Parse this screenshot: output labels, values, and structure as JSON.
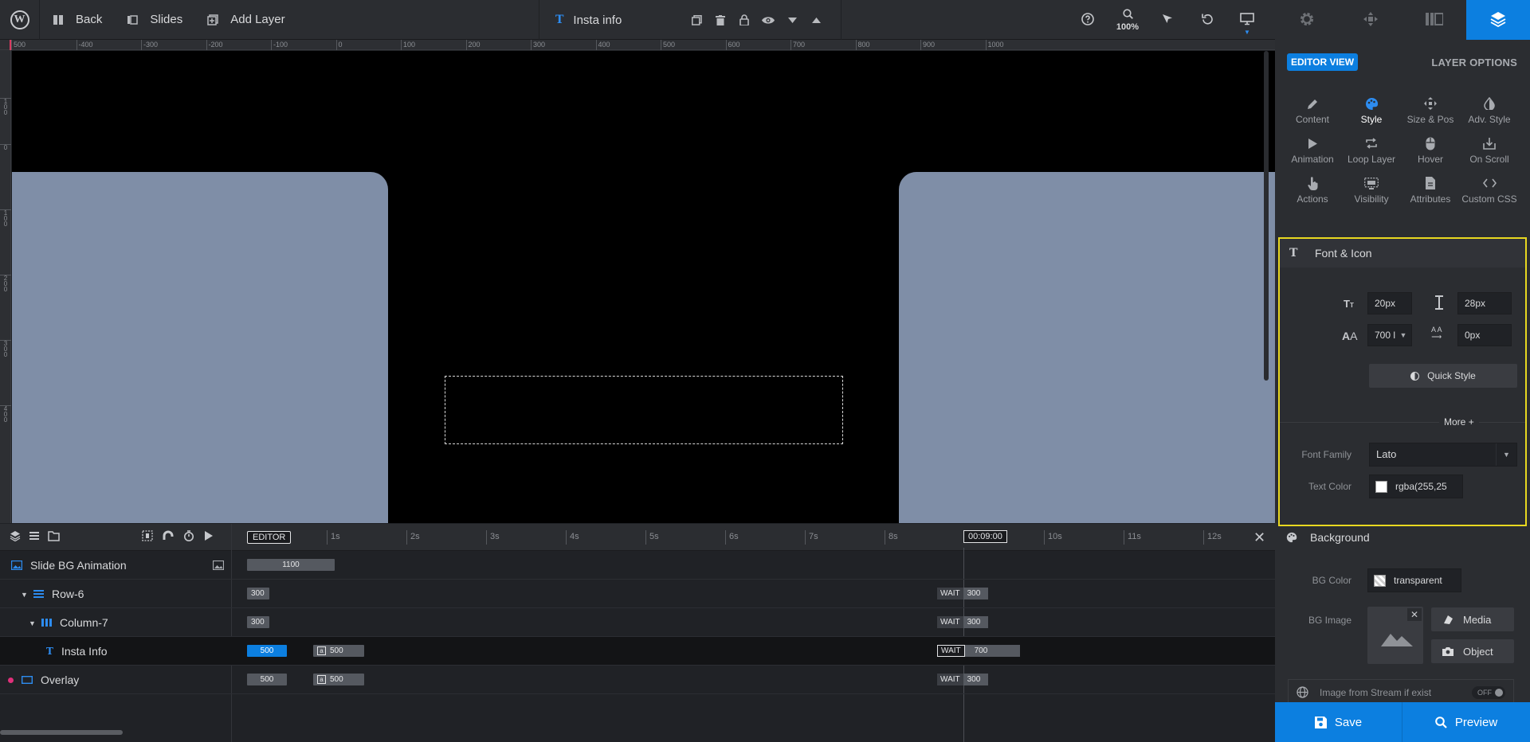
{
  "topbar": {
    "logo": "W",
    "back": "Back",
    "slides": "Slides",
    "add_layer": "Add Layer",
    "layer_name": "Insta info",
    "zoom": "100%"
  },
  "ruler": {
    "top": [
      "500",
      "-400",
      "-300",
      "-200",
      "-100",
      "0",
      "100",
      "200",
      "300",
      "400",
      "500",
      "600",
      "700",
      "800",
      "900",
      "1000"
    ],
    "left": [
      "1 0 0",
      "0",
      "1 0 0",
      "2 0 0",
      "3 0 0",
      "4 0 0"
    ]
  },
  "timeline": {
    "editor": "EDITOR",
    "seconds": [
      "1s",
      "2s",
      "3s",
      "4s",
      "5s",
      "6s",
      "7s",
      "8s",
      "10s",
      "11s",
      "12s"
    ],
    "current_time": "00:09:00",
    "rows": [
      {
        "label": "Slide BG Animation",
        "bar": "1100"
      },
      {
        "label": "Row-6",
        "bar": "300",
        "wait": "WAIT",
        "wait_val": "300"
      },
      {
        "label": "Column-7",
        "bar": "300",
        "wait": "WAIT",
        "wait_val": "300"
      },
      {
        "label": "Insta Info",
        "bar": "500",
        "bar2_icon": "a",
        "bar2": "500",
        "wait": "WAIT",
        "wait_val": "700"
      },
      {
        "label": "Overlay",
        "bar": "500",
        "bar2_icon": "a",
        "bar2": "500",
        "wait": "WAIT",
        "wait_val": "300"
      }
    ]
  },
  "panel": {
    "editor_view": "EDITOR VIEW",
    "layer_options": "LAYER OPTIONS",
    "options": [
      {
        "label": "Content",
        "icon": "pencil-icon"
      },
      {
        "label": "Style",
        "icon": "palette-icon"
      },
      {
        "label": "Size & Pos",
        "icon": "move-icon"
      },
      {
        "label": "Adv. Style",
        "icon": "contrast-icon"
      },
      {
        "label": "Animation",
        "icon": "play-icon"
      },
      {
        "label": "Loop Layer",
        "icon": "loop-icon"
      },
      {
        "label": "Hover",
        "icon": "mouse-icon"
      },
      {
        "label": "On Scroll",
        "icon": "scroll-icon"
      },
      {
        "label": "Actions",
        "icon": "hand-icon"
      },
      {
        "label": "Visibility",
        "icon": "visibility-icon"
      },
      {
        "label": "Attributes",
        "icon": "document-icon"
      },
      {
        "label": "Custom CSS",
        "icon": "code-icon"
      }
    ],
    "font": {
      "title": "Font & Icon",
      "font_size": "20px",
      "line_height": "28px",
      "font_weight": "700 l",
      "letter_spacing": "0px",
      "quick_style": "Quick Style",
      "more": "More",
      "font_family_label": "Font Family",
      "font_family": "Lato",
      "text_color_label": "Text Color",
      "text_color": "rgba(255,25"
    },
    "background": {
      "title": "Background",
      "bg_color_label": "BG Color",
      "bg_color": "transparent",
      "bg_image_label": "BG Image",
      "media": "Media",
      "object": "Object",
      "stream": "Image from Stream if exist",
      "toggle": "OFF"
    },
    "save": "Save",
    "preview": "Preview"
  },
  "colors": {
    "accent": "#0c7fe0",
    "card": "#7f8ea7",
    "highlight": "#e8d820"
  }
}
